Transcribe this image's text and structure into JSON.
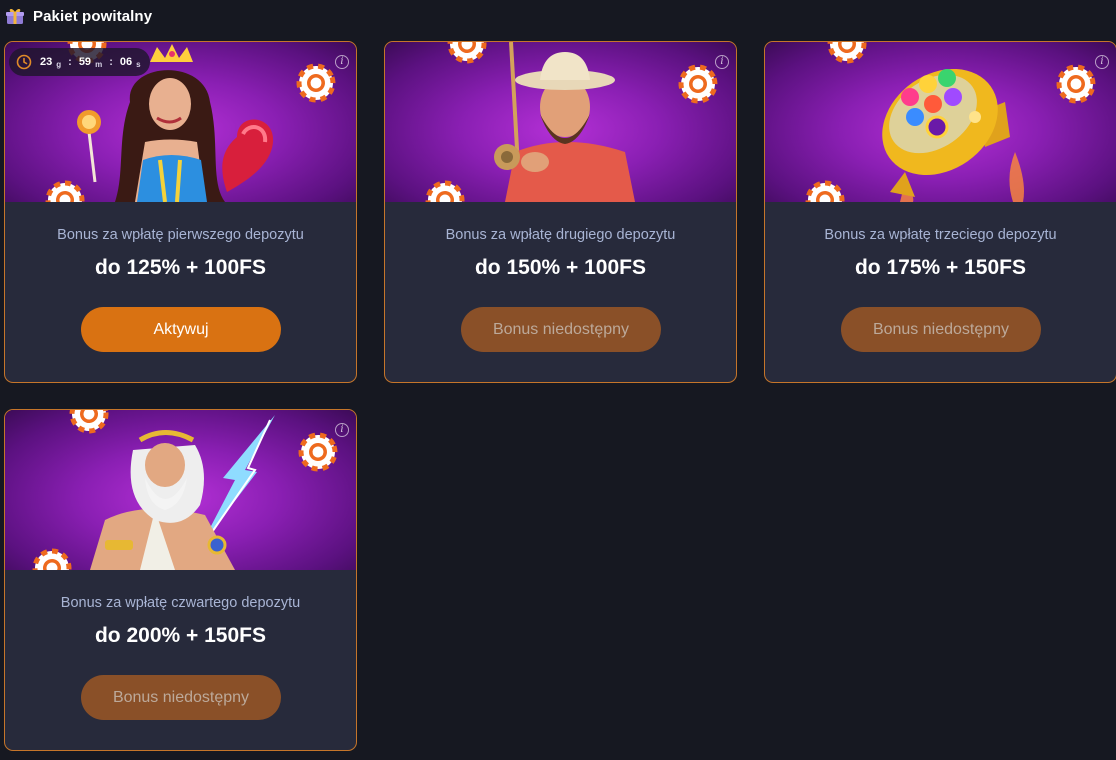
{
  "header": {
    "title": "Pakiet powitalny",
    "icon": "gift-icon"
  },
  "colors": {
    "accent": "#d97212",
    "disabled_button": "#8a5028",
    "card_border": "#c5752a",
    "card_bg": "#272a3b"
  },
  "cards": [
    {
      "timer": {
        "hours": "23",
        "hours_unit": "g",
        "minutes": "59",
        "minutes_unit": "m",
        "seconds": "06",
        "seconds_unit": "s"
      },
      "caption": "Bonus za wpłatę pierwszego depozytu",
      "amount": "do 125% + 100FS",
      "button": "Aktywuj",
      "button_state": "active",
      "art": "queen-character"
    },
    {
      "caption": "Bonus za wpłatę drugiego depozytu",
      "amount": "do 150% + 100FS",
      "button": "Bonus niedostępny",
      "button_state": "disabled",
      "art": "fisherman-character"
    },
    {
      "caption": "Bonus za wpłatę trzeciego depozytu",
      "amount": "do 175% + 150FS",
      "button": "Bonus niedostępny",
      "button_state": "disabled",
      "art": "rocket-character"
    },
    {
      "caption": "Bonus za wpłatę czwartego depozytu",
      "amount": "do 200% + 150FS",
      "button": "Bonus niedostępny",
      "button_state": "disabled",
      "art": "zeus-character"
    }
  ]
}
